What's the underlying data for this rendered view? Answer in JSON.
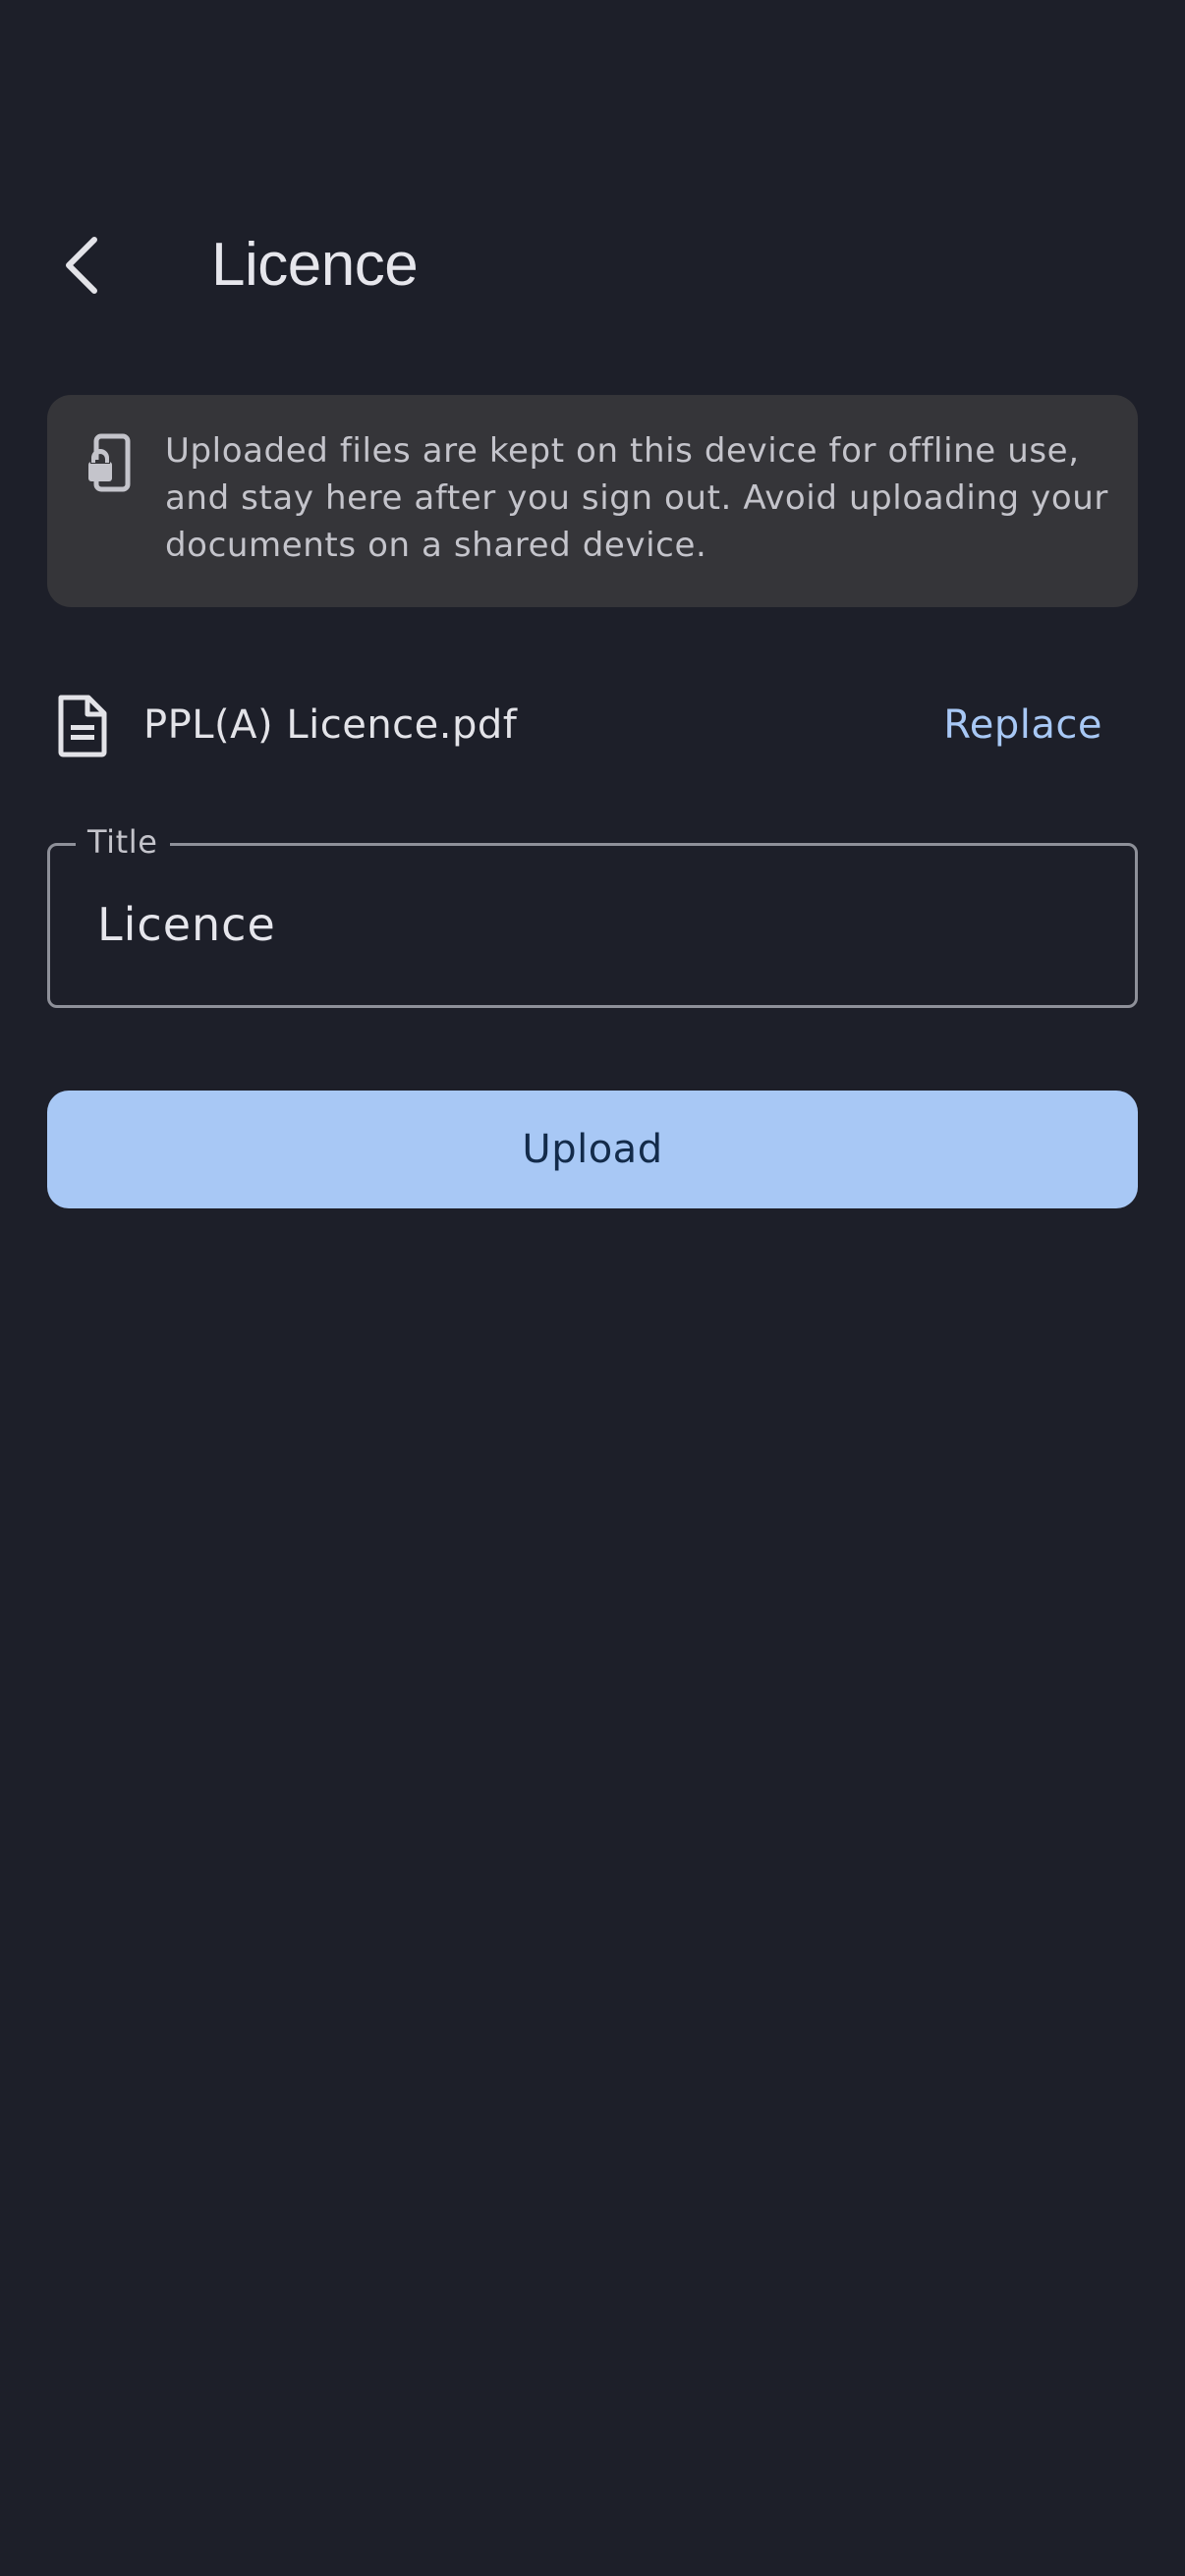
{
  "header": {
    "title": "Licence",
    "back_icon": "chevron-left-icon"
  },
  "banner": {
    "icon": "phone-lock-icon",
    "text": "Uploaded files are kept on this device for offline use, and stay here after you sign out. Avoid uploading your documents on a shared device."
  },
  "file": {
    "icon": "document-icon",
    "name": "PPL(A) Licence.pdf",
    "replace_label": "Replace"
  },
  "title_field": {
    "label": "Title",
    "value": "Licence"
  },
  "upload": {
    "label": "Upload"
  },
  "colors": {
    "background": "#1d1f29",
    "banner_background": "#353539",
    "accent": "#a8c8f5",
    "accent_text": "#132b4a"
  }
}
